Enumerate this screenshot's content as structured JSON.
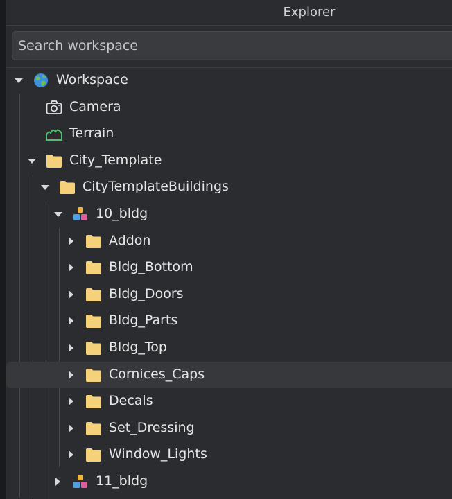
{
  "panel": {
    "title": "Explorer"
  },
  "search": {
    "placeholder": "Search workspace"
  },
  "tree": [
    {
      "label": "Workspace",
      "icon": "globe-icon",
      "expanded": true,
      "depth": 0
    },
    {
      "label": "Camera",
      "icon": "camera-icon",
      "depth": 1
    },
    {
      "label": "Terrain",
      "icon": "terrain-icon",
      "depth": 1
    },
    {
      "label": "City_Template",
      "icon": "folder-icon",
      "expanded": true,
      "depth": 1
    },
    {
      "label": "CityTemplateBuildings",
      "icon": "folder-icon",
      "expanded": true,
      "depth": 2
    },
    {
      "label": "10_bldg",
      "icon": "model-icon",
      "expanded": true,
      "depth": 3
    },
    {
      "label": "Addon",
      "icon": "folder-icon",
      "expanded": false,
      "depth": 4
    },
    {
      "label": "Bldg_Bottom",
      "icon": "folder-icon",
      "expanded": false,
      "depth": 4
    },
    {
      "label": "Bldg_Doors",
      "icon": "folder-icon",
      "expanded": false,
      "depth": 4
    },
    {
      "label": "Bldg_Parts",
      "icon": "folder-icon",
      "expanded": false,
      "depth": 4
    },
    {
      "label": "Bldg_Top",
      "icon": "folder-icon",
      "expanded": false,
      "depth": 4
    },
    {
      "label": "Cornices_Caps",
      "icon": "folder-icon",
      "expanded": false,
      "depth": 4,
      "hovered": true
    },
    {
      "label": "Decals",
      "icon": "folder-icon",
      "expanded": false,
      "depth": 4
    },
    {
      "label": "Set_Dressing",
      "icon": "folder-icon",
      "expanded": false,
      "depth": 4
    },
    {
      "label": "Window_Lights",
      "icon": "folder-icon",
      "expanded": false,
      "depth": 4
    },
    {
      "label": "11_bldg",
      "icon": "model-icon",
      "expanded": false,
      "depth": 3
    }
  ],
  "colors": {
    "folder": "#f5d27a",
    "terrain": "#4fbf6a",
    "globe_blue": "#3d8fe0",
    "globe_green": "#6cc24a"
  }
}
